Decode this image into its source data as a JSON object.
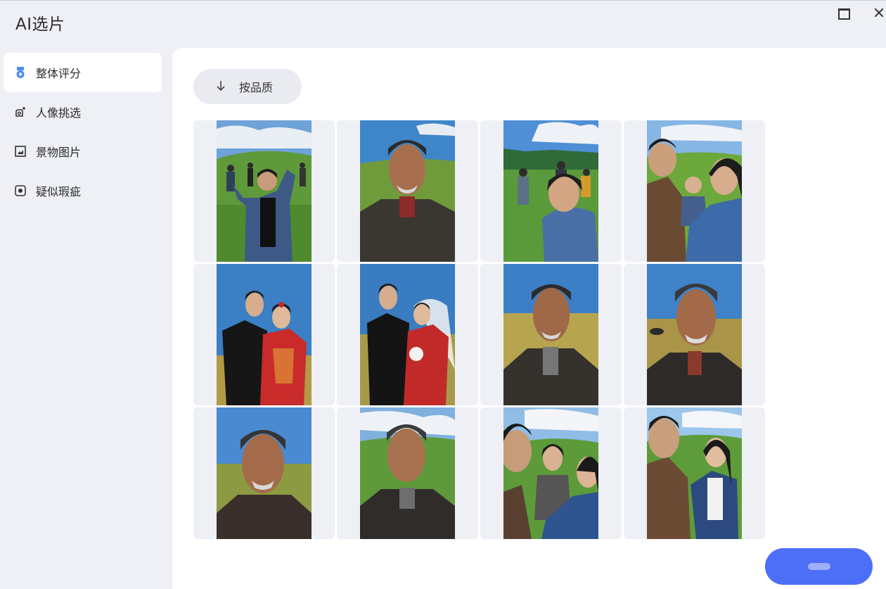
{
  "app": {
    "title": "AI选片"
  },
  "window": {
    "maximize_icon": "maximize-icon",
    "close_icon": "close-icon"
  },
  "sidebar": {
    "items": [
      {
        "label": "整体评分",
        "icon": "medal-icon",
        "active": true
      },
      {
        "label": "人像挑选",
        "icon": "portrait-pick-icon",
        "active": false
      },
      {
        "label": "景物图片",
        "icon": "scenery-icon",
        "active": false
      },
      {
        "label": "疑似瑕疵",
        "icon": "flaw-icon",
        "active": false
      }
    ]
  },
  "toolbar": {
    "sort_label": "按品质",
    "sort_icon": "arrow-down-icon"
  },
  "photos": [
    {
      "subject": "young man in denim jacket waving, friends on grassland"
    },
    {
      "subject": "elderly man portrait, grassland"
    },
    {
      "subject": "smiling woman with group of friends"
    },
    {
      "subject": "family laughing together"
    },
    {
      "subject": "wedding couple, red dress"
    },
    {
      "subject": "wedding couple with bouquet and veil"
    },
    {
      "subject": "elderly man portrait, golden field"
    },
    {
      "subject": "elderly man portrait, prairie with horses"
    },
    {
      "subject": "elderly man portrait, close-up"
    },
    {
      "subject": "elderly man portrait, green hills"
    },
    {
      "subject": "friends chatting on meadow"
    },
    {
      "subject": "couple smiling on meadow"
    }
  ],
  "colors": {
    "accent": "#4d6ef7",
    "sidebar_bg": "#eef0f6",
    "content_bg": "#ffffff"
  }
}
